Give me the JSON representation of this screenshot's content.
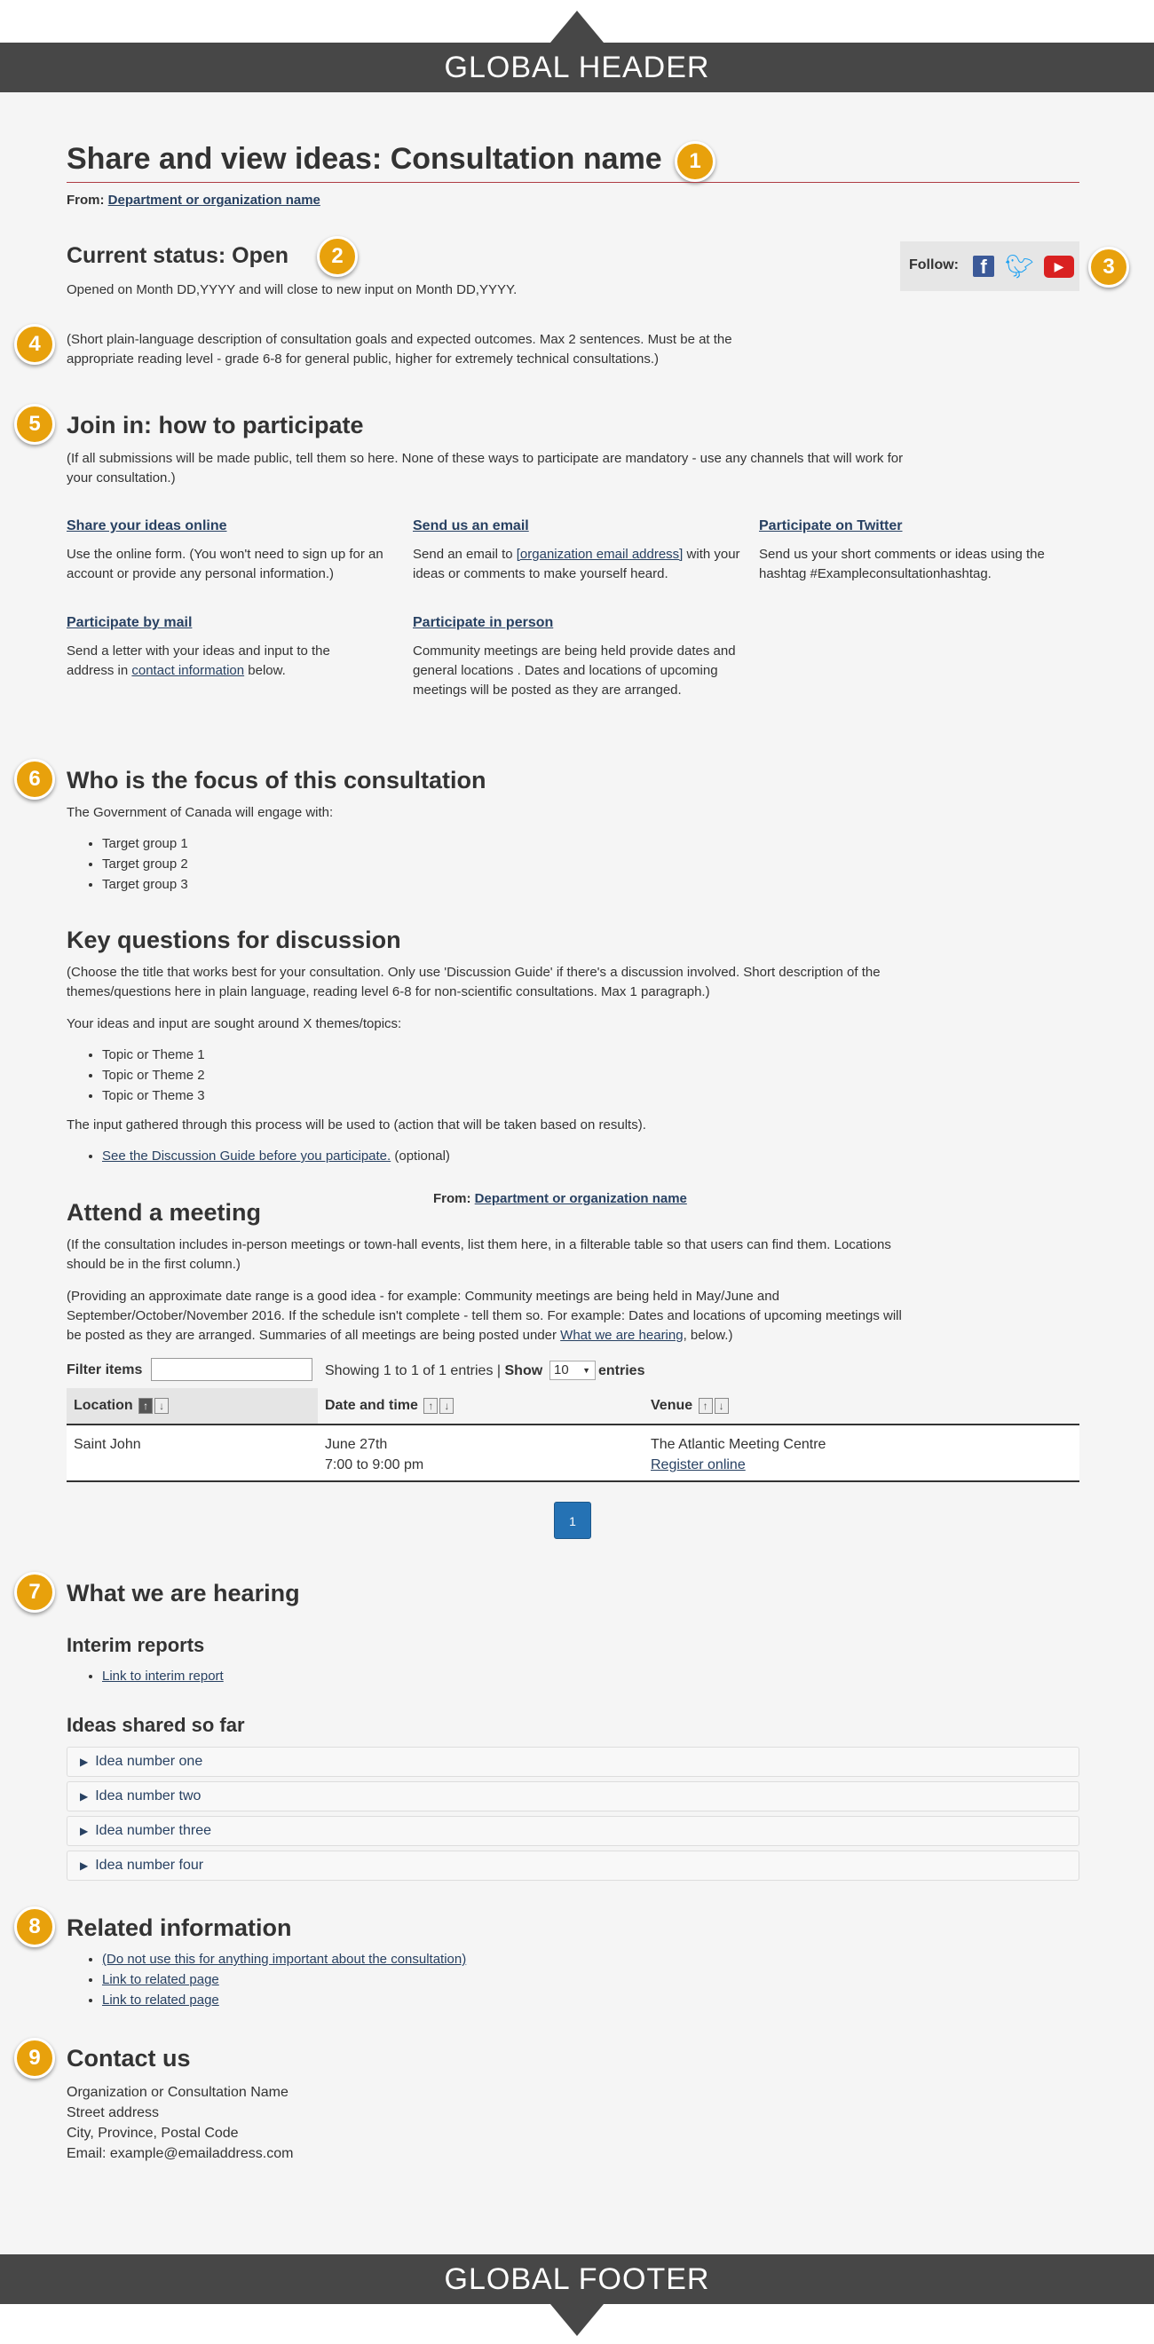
{
  "global_header": "GLOBAL HEADER",
  "global_footer": "GLOBAL FOOTER",
  "badges": [
    "1",
    "2",
    "3",
    "4",
    "5",
    "6",
    "7",
    "8",
    "9"
  ],
  "page_title": "Share and view ideas: Consultation name",
  "from_label": "From:",
  "from_link": "Department or organization name",
  "status": {
    "heading": "Current status: Open",
    "dates": "Opened on Month DD,YYYY and will close to new input on Month DD,YYYY."
  },
  "follow": {
    "label": "Follow:",
    "icons": [
      "facebook-icon",
      "twitter-icon",
      "youtube-icon"
    ]
  },
  "description": "(Short plain-language description of consultation goals and expected outcomes. Max 2 sentences. Must be at the appropriate reading level - grade 6-8 for general public, higher for extremely technical consultations.)",
  "join": {
    "heading": "Join in: how to participate",
    "intro": "(If all submissions will be made public, tell them so here. None of these ways to participate are mandatory - use any channels that will work for your consultation.)",
    "online": {
      "title": "Share your ideas online",
      "text": "Use the online form. (You won't need to sign up for an account or provide any personal information.)"
    },
    "email": {
      "title": "Send us an email",
      "text_before": "Send an email to ",
      "link": "[organization email address]",
      "text_after": " with your ideas or comments to make yourself heard."
    },
    "twitter": {
      "title": "Participate on Twitter",
      "text": "Send us your short comments or ideas using the hashtag #Exampleconsultationhashtag."
    },
    "mail": {
      "title": "Participate by mail",
      "text_before": "Send a letter with your ideas and input to the address in ",
      "link": "contact information",
      "text_after": " below."
    },
    "person": {
      "title": "Participate in person",
      "text": "Community meetings are being held provide dates and general locations . Dates and locations of upcoming meetings will be posted as they are arranged."
    }
  },
  "focus": {
    "heading": "Who is the focus of this consultation",
    "intro": "The Government of Canada will engage with:",
    "groups": [
      "Target group 1",
      "Target group 2",
      "Target group 3"
    ]
  },
  "questions": {
    "heading": "Key questions for discussion",
    "intro": "(Choose the title that works best for your consultation. Only use 'Discussion Guide' if there's a discussion involved. Short description of the themes/questions here in plain language, reading level 6-8 for non-scientific consultations. Max 1 paragraph.)",
    "sought": "Your ideas and input are sought around X themes/topics:",
    "topics": [
      "Topic or Theme 1",
      "Topic or Theme 2",
      "Topic or Theme 3"
    ],
    "use": "The input gathered through this process will be used to (action that will be taken based on results).",
    "guide_link": "See the Discussion Guide before you participate.",
    "guide_optional": " (optional)"
  },
  "meeting": {
    "heading": "Attend a meeting",
    "from_label": "From:",
    "from_link": "Department or organization name",
    "p1": "(If the consultation includes in-person meetings or town-hall events, list them here, in a filterable table so that users can find them. Locations should be in the first column.)",
    "p2_before": "(Providing an approximate date range is a good idea - for example: Community meetings are being held in May/June and September/October/November 2016. If the schedule isn't complete - tell them so. For example: Dates and locations of upcoming meetings will be posted as they are arranged. Summaries of all meetings are being posted under ",
    "p2_link": "What we are hearing",
    "p2_after": ", below.)",
    "filter_label": "Filter items",
    "entries_info": "Showing 1 to 1 of 1 entries",
    "show_label": "Show",
    "show_value": "10",
    "entries_label": "entries",
    "columns": [
      "Location",
      "Date and time",
      "Venue"
    ],
    "row": {
      "location": "Saint John",
      "date": "June 27th",
      "time": "7:00 to 9:00 pm",
      "venue": "The Atlantic Meeting Centre",
      "register": "Register online"
    },
    "page": "1"
  },
  "hearing": {
    "heading": "What we are hearing",
    "interim_heading": "Interim reports",
    "interim_link": "Link to interim report",
    "ideas_heading": "Ideas shared so far",
    "ideas": [
      "Idea number one",
      "Idea number two",
      "Idea number three",
      "Idea number four"
    ]
  },
  "related": {
    "heading": "Related information",
    "links": [
      "(Do not use this for anything important about the consultation)",
      "Link to related page",
      "Link to related page"
    ]
  },
  "contact": {
    "heading": "Contact us",
    "lines": [
      "Organization or Consultation Name",
      "Street address",
      "City, Province, Postal Code",
      "Email: example@emailaddress.com"
    ]
  },
  "colors": {
    "badge": "#e8a10c",
    "link": "#284162",
    "title_rule": "#af3c43",
    "page_button": "#2572b4",
    "bar": "#474747"
  }
}
